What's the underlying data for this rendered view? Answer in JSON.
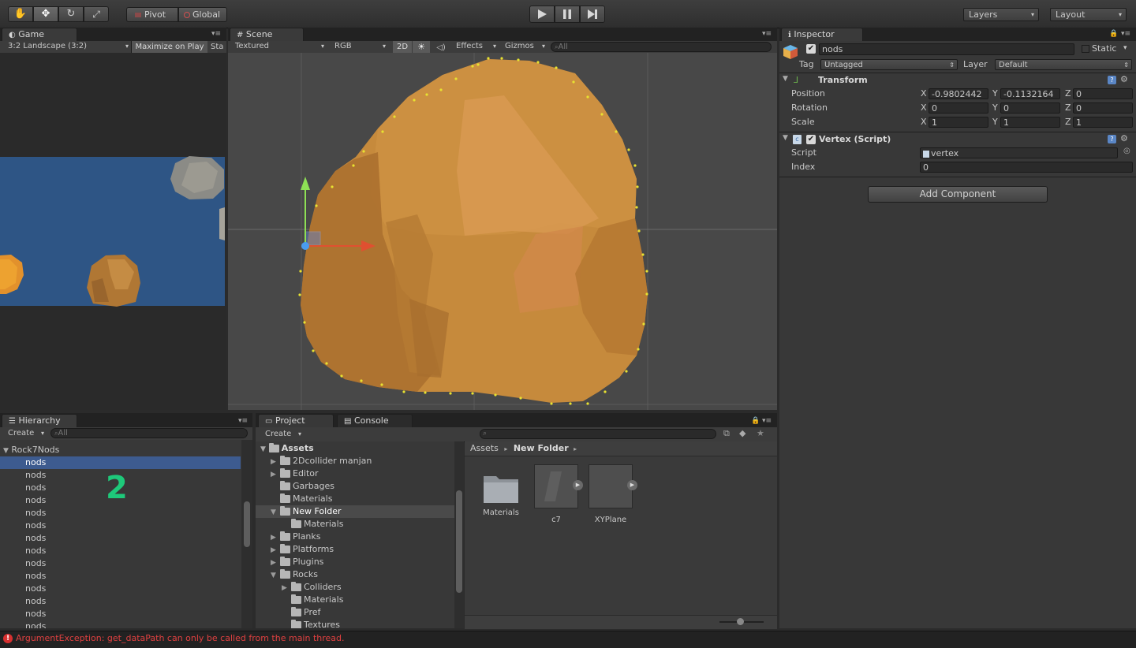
{
  "toolbar": {
    "pivot_label": "Pivot",
    "global_label": "Global",
    "layers_label": "Layers",
    "layout_label": "Layout"
  },
  "game": {
    "tab_label": "Game",
    "aspect_label": "3:2 Landscape (3:2)",
    "maximize_label": "Maximize on Play",
    "stats_label": "Sta"
  },
  "scene": {
    "tab_label": "Scene",
    "render_mode": "Textured",
    "color_mode": "RGB",
    "mode_2d": "2D",
    "effects_label": "Effects",
    "gizmos_label": "Gizmos",
    "search_placeholder": "All"
  },
  "inspector": {
    "tab_label": "Inspector",
    "object_name": "nods",
    "static_label": "Static",
    "tag_label": "Tag",
    "tag_value": "Untagged",
    "layer_label": "Layer",
    "layer_value": "Default",
    "transform": {
      "title": "Transform",
      "position_label": "Position",
      "rotation_label": "Rotation",
      "scale_label": "Scale",
      "position": {
        "x": "-0.9802442",
        "y": "-0.1132164",
        "z": "0"
      },
      "rotation": {
        "x": "0",
        "y": "0",
        "z": "0"
      },
      "scale": {
        "x": "1",
        "y": "1",
        "z": "1"
      }
    },
    "script_component": {
      "title": "Vertex (Script)",
      "script_label": "Script",
      "script_value": "vertex",
      "index_label": "Index",
      "index_value": "0"
    },
    "add_component_label": "Add Component"
  },
  "hierarchy": {
    "tab_label": "Hierarchy",
    "create_label": "Create",
    "search_placeholder": "All",
    "root_label": "Rock7Nods",
    "items": [
      "nods",
      "nods",
      "nods",
      "nods",
      "nods",
      "nods",
      "nods",
      "nods",
      "nods",
      "nods",
      "nods",
      "nods",
      "nods",
      "nods"
    ],
    "overlay_number": "2"
  },
  "project": {
    "tab_label": "Project",
    "console_tab_label": "Console",
    "create_label": "Create",
    "tree": {
      "assets_label": "Assets",
      "items": [
        "2Dcollider manjan",
        "Editor",
        "Garbages",
        "Materials",
        "New Folder",
        "Materials",
        "Planks",
        "Platforms",
        "Plugins",
        "Rocks",
        "Colliders",
        "Materials",
        "Pref",
        "Textures"
      ]
    },
    "breadcrumb": {
      "root": "Assets",
      "current": "New Folder"
    },
    "assets": [
      "Materials",
      "c7",
      "XYPlane"
    ]
  },
  "status": {
    "error_message": "ArgumentException: get_dataPath can only be called from the main thread."
  },
  "colors": {
    "accent_green": "#1ec97a",
    "selection_blue": "#3d5b8f",
    "error_red": "#d73030",
    "rock_orange": "#c98a3c"
  }
}
